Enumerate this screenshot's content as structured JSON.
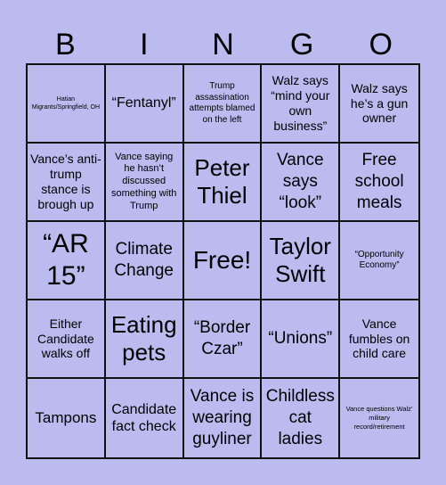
{
  "header": {
    "letters": [
      "B",
      "I",
      "N",
      "G",
      "O"
    ]
  },
  "board": {
    "cells": [
      "Hatian Migrants/Springfield, OH",
      "“Fentanyl”",
      "Trump assassination attempts blamed on the left",
      "Walz says “mind your own business”",
      "Walz says he’s a gun owner",
      "Vance’s anti-trump stance is brough up",
      "Vance saying he hasn’t discussed something with Trump",
      "Peter Thiel",
      "Vance says “look”",
      "Free school meals",
      "“AR 15”",
      "Climate Change",
      "Free!",
      "Taylor Swift",
      "“Opportunity Economy”",
      "Either Candidate walks off",
      "Eating pets",
      "“Border Czar”",
      "“Unions”",
      "Vance fumbles on child care",
      "Tampons",
      "Candidate fact check",
      "Vance is wearing guyliner",
      "Childless cat ladies",
      "Vance questions Walz’ military record/retirement"
    ],
    "free_space_index": 12
  },
  "colors": {
    "background": "#bbbbf0",
    "grid_line": "#111111",
    "text": "#000000"
  }
}
